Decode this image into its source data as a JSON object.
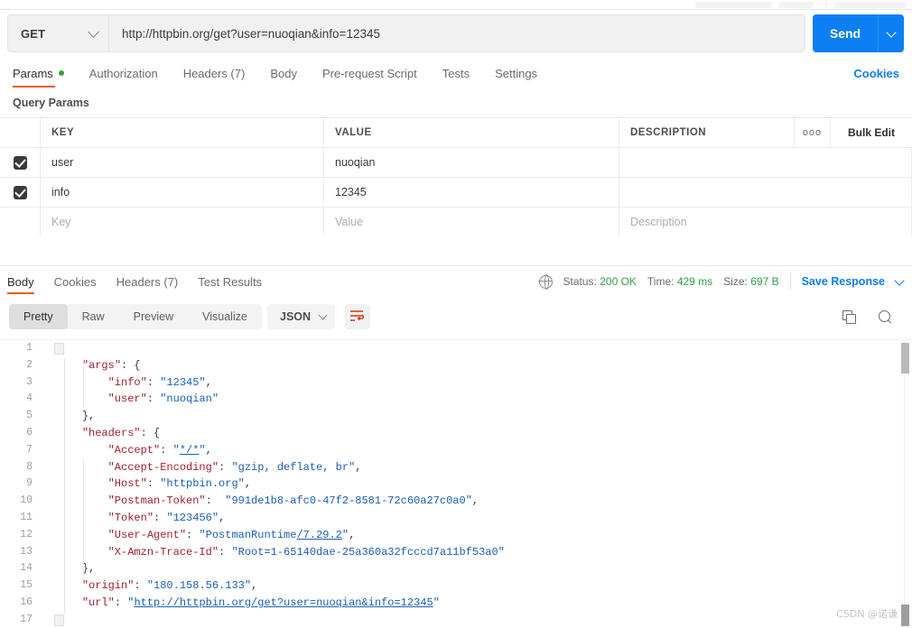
{
  "request": {
    "method": "GET",
    "url": "http://httpbin.org/get?user=nuoqian&info=12345",
    "send_label": "Send",
    "cookies_label": "Cookies",
    "tabs": [
      {
        "label": "Params",
        "active": true,
        "dot": true
      },
      {
        "label": "Authorization",
        "active": false,
        "dot": false
      },
      {
        "label": "Headers (7)",
        "active": false,
        "dot": false
      },
      {
        "label": "Body",
        "active": false,
        "dot": false
      },
      {
        "label": "Pre-request Script",
        "active": false,
        "dot": false
      },
      {
        "label": "Tests",
        "active": false,
        "dot": false
      },
      {
        "label": "Settings",
        "active": false,
        "dot": false
      }
    ]
  },
  "query_params": {
    "section_title": "Query Params",
    "columns": {
      "key": "KEY",
      "value": "VALUE",
      "description": "DESCRIPTION"
    },
    "bulk_edit_label": "Bulk Edit",
    "more_options_icon": "ooo",
    "rows": [
      {
        "checked": true,
        "key": "user",
        "value": "nuoqian",
        "description": ""
      },
      {
        "checked": true,
        "key": "info",
        "value": "12345",
        "description": ""
      }
    ],
    "placeholder_row": {
      "key": "Key",
      "value": "Value",
      "description": "Description"
    }
  },
  "response": {
    "tabs": [
      {
        "label": "Body",
        "active": true
      },
      {
        "label": "Cookies",
        "active": false
      },
      {
        "label": "Headers (7)",
        "active": false
      },
      {
        "label": "Test Results",
        "active": false
      }
    ],
    "status_label": "Status:",
    "status_value": "200 OK",
    "time_label": "Time:",
    "time_value": "429 ms",
    "size_label": "Size:",
    "size_value": "697 B",
    "save_response_label": "Save Response",
    "view_modes": [
      {
        "label": "Pretty",
        "active": true
      },
      {
        "label": "Raw",
        "active": false
      },
      {
        "label": "Preview",
        "active": false
      },
      {
        "label": "Visualize",
        "active": false
      }
    ],
    "format": "JSON",
    "body_lines": [
      {
        "n": 1,
        "indent": 0,
        "segs": [
          {
            "t": "{",
            "c": "p"
          }
        ]
      },
      {
        "n": 2,
        "indent": 1,
        "segs": [
          {
            "t": "\"args\"",
            "c": "k"
          },
          {
            "t": ": {",
            "c": "p"
          }
        ]
      },
      {
        "n": 3,
        "indent": 2,
        "segs": [
          {
            "t": "\"info\"",
            "c": "k"
          },
          {
            "t": ": ",
            "c": "p"
          },
          {
            "t": "\"12345\"",
            "c": "s"
          },
          {
            "t": ",",
            "c": "p"
          }
        ]
      },
      {
        "n": 4,
        "indent": 2,
        "segs": [
          {
            "t": "\"user\"",
            "c": "k"
          },
          {
            "t": ": ",
            "c": "p"
          },
          {
            "t": "\"nuoqian\"",
            "c": "s"
          }
        ]
      },
      {
        "n": 5,
        "indent": 1,
        "segs": [
          {
            "t": "},",
            "c": "p"
          }
        ]
      },
      {
        "n": 6,
        "indent": 1,
        "segs": [
          {
            "t": "\"headers\"",
            "c": "k"
          },
          {
            "t": ": {",
            "c": "p"
          }
        ]
      },
      {
        "n": 7,
        "indent": 2,
        "segs": [
          {
            "t": "\"Accept\"",
            "c": "k"
          },
          {
            "t": ": ",
            "c": "p"
          },
          {
            "t": "\"",
            "c": "s"
          },
          {
            "t": "*/*",
            "c": "u"
          },
          {
            "t": "\"",
            "c": "s"
          },
          {
            "t": ",",
            "c": "p"
          }
        ]
      },
      {
        "n": 8,
        "indent": 2,
        "segs": [
          {
            "t": "\"Accept-Encoding\"",
            "c": "k"
          },
          {
            "t": ": ",
            "c": "p"
          },
          {
            "t": "\"gzip, deflate, br\"",
            "c": "s"
          },
          {
            "t": ",",
            "c": "p"
          }
        ]
      },
      {
        "n": 9,
        "indent": 2,
        "segs": [
          {
            "t": "\"Host\"",
            "c": "k"
          },
          {
            "t": ": ",
            "c": "p"
          },
          {
            "t": "\"httpbin.org\"",
            "c": "s"
          },
          {
            "t": ",",
            "c": "p"
          }
        ]
      },
      {
        "n": 10,
        "indent": 2,
        "segs": [
          {
            "t": "\"Postman-Token\"",
            "c": "k"
          },
          {
            "t": ":  ",
            "c": "p"
          },
          {
            "t": "\"991de1b8-afc0-47f2-8581-72c60a27c0a0\"",
            "c": "s"
          },
          {
            "t": ",",
            "c": "p"
          }
        ]
      },
      {
        "n": 11,
        "indent": 2,
        "segs": [
          {
            "t": "\"Token\"",
            "c": "k"
          },
          {
            "t": ": ",
            "c": "p"
          },
          {
            "t": "\"123456\"",
            "c": "s"
          },
          {
            "t": ",",
            "c": "p"
          }
        ]
      },
      {
        "n": 12,
        "indent": 2,
        "segs": [
          {
            "t": "\"User-Agent\"",
            "c": "k"
          },
          {
            "t": ": ",
            "c": "p"
          },
          {
            "t": "\"PostmanRuntime",
            "c": "s"
          },
          {
            "t": "/7.29.2",
            "c": "u"
          },
          {
            "t": "\"",
            "c": "s"
          },
          {
            "t": ",",
            "c": "p"
          }
        ]
      },
      {
        "n": 13,
        "indent": 2,
        "segs": [
          {
            "t": "\"X-Amzn-Trace-Id\"",
            "c": "k"
          },
          {
            "t": ": ",
            "c": "p"
          },
          {
            "t": "\"Root=1-65140dae-25a360a32fcccd7a11bf53a0\"",
            "c": "s"
          }
        ]
      },
      {
        "n": 14,
        "indent": 1,
        "segs": [
          {
            "t": "},",
            "c": "p"
          }
        ]
      },
      {
        "n": 15,
        "indent": 1,
        "segs": [
          {
            "t": "\"origin\"",
            "c": "k"
          },
          {
            "t": ": ",
            "c": "p"
          },
          {
            "t": "\"180.158.56.133\"",
            "c": "s"
          },
          {
            "t": ",",
            "c": "p"
          }
        ]
      },
      {
        "n": 16,
        "indent": 1,
        "segs": [
          {
            "t": "\"url\"",
            "c": "k"
          },
          {
            "t": ": ",
            "c": "p"
          },
          {
            "t": "\"",
            "c": "s"
          },
          {
            "t": "http://httpbin.org/get?user=nuoqian&info=12345",
            "c": "u"
          },
          {
            "t": "\"",
            "c": "s"
          }
        ]
      },
      {
        "n": 17,
        "indent": 0,
        "segs": [
          {
            "t": "}",
            "c": "p"
          }
        ]
      }
    ]
  },
  "watermark": "CSDN @诺谦"
}
